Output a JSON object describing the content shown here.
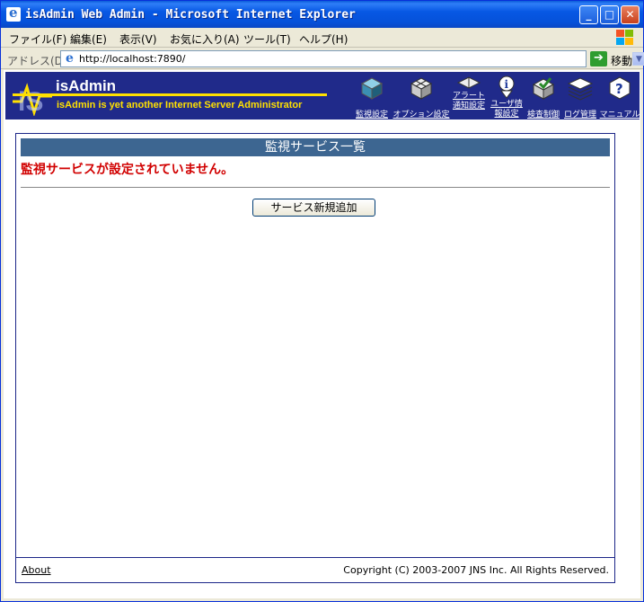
{
  "window": {
    "title": "isAdmin Web Admin - Microsoft Internet Explorer",
    "controls": {
      "minimize": "_",
      "maximize": "□",
      "close": "✕"
    }
  },
  "menubar": {
    "items": [
      {
        "label": "ファイル(F)"
      },
      {
        "label": "編集(E)"
      },
      {
        "label": "表示(V)"
      },
      {
        "label": "お気に入り(A)"
      },
      {
        "label": "ツール(T)"
      },
      {
        "label": "ヘルプ(H)"
      }
    ]
  },
  "addressbar": {
    "label": "アドレス(D)",
    "url": "http://localhost:7890/",
    "go_label": "移動"
  },
  "app": {
    "name": "isAdmin",
    "tagline": "isAdmin is yet another Internet Server Administrator",
    "colors": {
      "header_bg": "#202a8a",
      "accent": "#ffe000",
      "panel_header": "#3d6691",
      "error": "#d10000"
    },
    "nav": [
      {
        "label": "監視設定",
        "icon": "cube-icon"
      },
      {
        "label": "オプション設定",
        "icon": "network-cube-icon"
      },
      {
        "label": "アラート通知設定",
        "icon": "alert-icon"
      },
      {
        "label": "ユーザ情報設定",
        "icon": "user-info-icon"
      },
      {
        "label": "検査制御",
        "icon": "inspection-icon"
      },
      {
        "label": "ログ管理",
        "icon": "log-stack-icon"
      },
      {
        "label": "マニュアル",
        "icon": "help-icon"
      }
    ]
  },
  "panel": {
    "title": "監視サービス一覧",
    "message": "監視サービスが設定されていません。",
    "add_button": "サービス新規追加",
    "about": "About",
    "copyright": "Copyright (C) 2003-2007 JNS Inc. All Rights Reserved."
  }
}
